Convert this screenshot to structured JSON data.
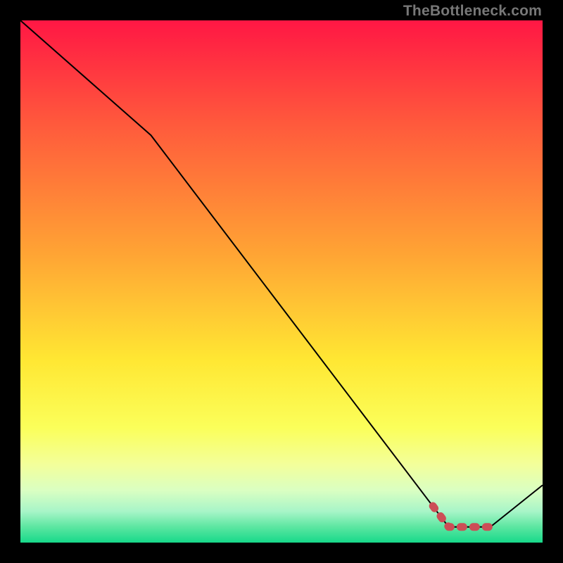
{
  "attribution": "TheBottleneck.com",
  "chart_data": {
    "type": "line",
    "title": "",
    "xlabel": "",
    "ylabel": "",
    "xlim": [
      0,
      100
    ],
    "ylim": [
      0,
      100
    ],
    "grid": false,
    "series": [
      {
        "name": "curve",
        "style": "thin-black",
        "x": [
          0,
          25,
          82,
          90,
          100
        ],
        "y": [
          100,
          78,
          3,
          3,
          11
        ]
      },
      {
        "name": "optimum-marker",
        "style": "thick-red-dashed",
        "x": [
          79,
          82,
          90
        ],
        "y": [
          7,
          3,
          3
        ]
      }
    ],
    "background_gradient": {
      "stops": [
        {
          "pct": 0,
          "color": "#ff1744"
        },
        {
          "pct": 20,
          "color": "#ff5a3c"
        },
        {
          "pct": 45,
          "color": "#ffa534"
        },
        {
          "pct": 65,
          "color": "#ffe733"
        },
        {
          "pct": 78,
          "color": "#fbff5a"
        },
        {
          "pct": 85,
          "color": "#f3ff9a"
        },
        {
          "pct": 90,
          "color": "#daffc2"
        },
        {
          "pct": 94,
          "color": "#a8f5c8"
        },
        {
          "pct": 97,
          "color": "#5ce6a1"
        },
        {
          "pct": 100,
          "color": "#17d98a"
        }
      ]
    }
  }
}
